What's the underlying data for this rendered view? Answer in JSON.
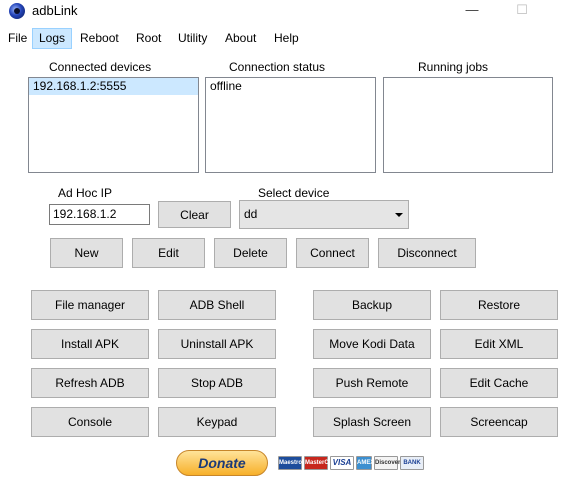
{
  "window": {
    "title": "adbLink",
    "minimize": "—",
    "maximize": "☐"
  },
  "menu": [
    "File",
    "Logs",
    "Reboot",
    "Root",
    "Utility",
    "About",
    "Help"
  ],
  "panels": {
    "connected_devices": {
      "label": "Connected devices",
      "items": [
        "192.168.1.2:5555"
      ]
    },
    "connection_status": {
      "label": "Connection status",
      "items": [
        "offline"
      ]
    },
    "running_jobs": {
      "label": "Running jobs",
      "items": []
    }
  },
  "adhoc": {
    "label": "Ad Hoc IP",
    "value": "192.168.1.2",
    "clear": "Clear"
  },
  "select_device": {
    "label": "Select device",
    "value": "dd"
  },
  "device_buttons": [
    "New",
    "Edit",
    "Delete",
    "Connect",
    "Disconnect"
  ],
  "tool_buttons": {
    "left": [
      [
        "File manager",
        "ADB Shell"
      ],
      [
        "Install APK",
        "Uninstall APK"
      ],
      [
        "Refresh ADB",
        "Stop ADB"
      ],
      [
        "Console",
        "Keypad"
      ]
    ],
    "right": [
      [
        "Backup",
        "Restore"
      ],
      [
        "Move Kodi Data",
        "Edit XML"
      ],
      [
        "Push Remote",
        "Edit Cache"
      ],
      [
        "Splash Screen",
        "Screencap"
      ]
    ]
  },
  "donate": {
    "label": "Donate",
    "cards": [
      "Maestro",
      "MasterCard",
      "VISA",
      "AMEX",
      "Discover",
      "BANK"
    ]
  }
}
